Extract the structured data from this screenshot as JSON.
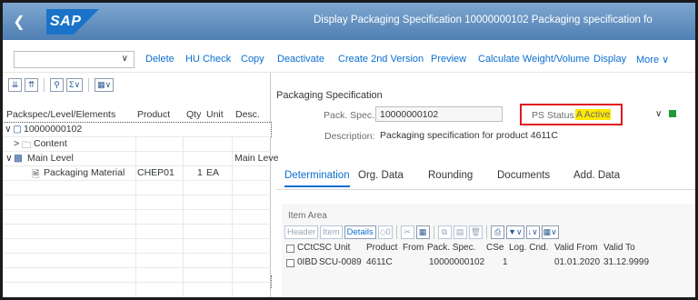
{
  "shell": {
    "back_icon": "chevron-left-icon",
    "logo_text": "SAP",
    "title": "Display Packaging Specification 10000000102 Packaging specification fo",
    "brand_color": "#5a86b8"
  },
  "toolbar": {
    "select_value": "",
    "buttons": [
      "Delete",
      "HU Check",
      "Copy",
      "Deactivate",
      "Create 2nd Version",
      "Preview",
      "Calculate Weight/Volume",
      "Display",
      "More"
    ]
  },
  "tree": {
    "tools": [
      "expand-all-icon",
      "collapse-all-icon",
      "find-icon",
      "sum-icon",
      "layout-icon"
    ],
    "columns": [
      "Packspec/Level/Elements",
      "Product",
      "Qty",
      "Unit",
      "Desc."
    ],
    "rows": [
      {
        "label": "10000000102",
        "product": "",
        "qty": "",
        "unit": "",
        "desc": ""
      },
      {
        "label": "Content",
        "product": "",
        "qty": "",
        "unit": "",
        "desc": ""
      },
      {
        "label": "Main Level",
        "product": "",
        "qty": "",
        "unit": "",
        "desc": "Main Leve"
      },
      {
        "label": "Packaging Material",
        "product": "CHEP01",
        "qty": "1",
        "unit": "EA",
        "desc": ""
      }
    ]
  },
  "spec": {
    "section_title": "Packaging Specification",
    "pack_spec_label": "Pack. Spec.:",
    "pack_spec_value": "10000000102",
    "ps_status_label": "PS Status:",
    "ps_status_value": "A Active",
    "description_label": "Description:",
    "description_value": "Packaging specification for product 4611C",
    "highlight_color": "#ffe800",
    "status_box_color": "#e0161e",
    "status_led_color": "#1f9a3a"
  },
  "tabs": [
    "Determination",
    "Org. Data",
    "Rounding",
    "Documents",
    "Add. Data"
  ],
  "item_area": {
    "title": "Item Area",
    "buttons": [
      "Header",
      "Item",
      "Details"
    ],
    "counter": "0",
    "columns": [
      "CCtC",
      "SC Unit",
      "Product",
      "From",
      "Pack. Spec.",
      "CSe",
      "Log. Cnd.",
      "Valid From",
      "Valid To"
    ],
    "rows": [
      {
        "cctc": "0IBD",
        "sc_unit": "SCU-0089",
        "product": "4611C",
        "from": "",
        "pack_spec": "10000000102",
        "cse": "1",
        "log_cnd": "",
        "valid_from": "01.01.2020",
        "valid_to": "31.12.9999"
      }
    ]
  }
}
